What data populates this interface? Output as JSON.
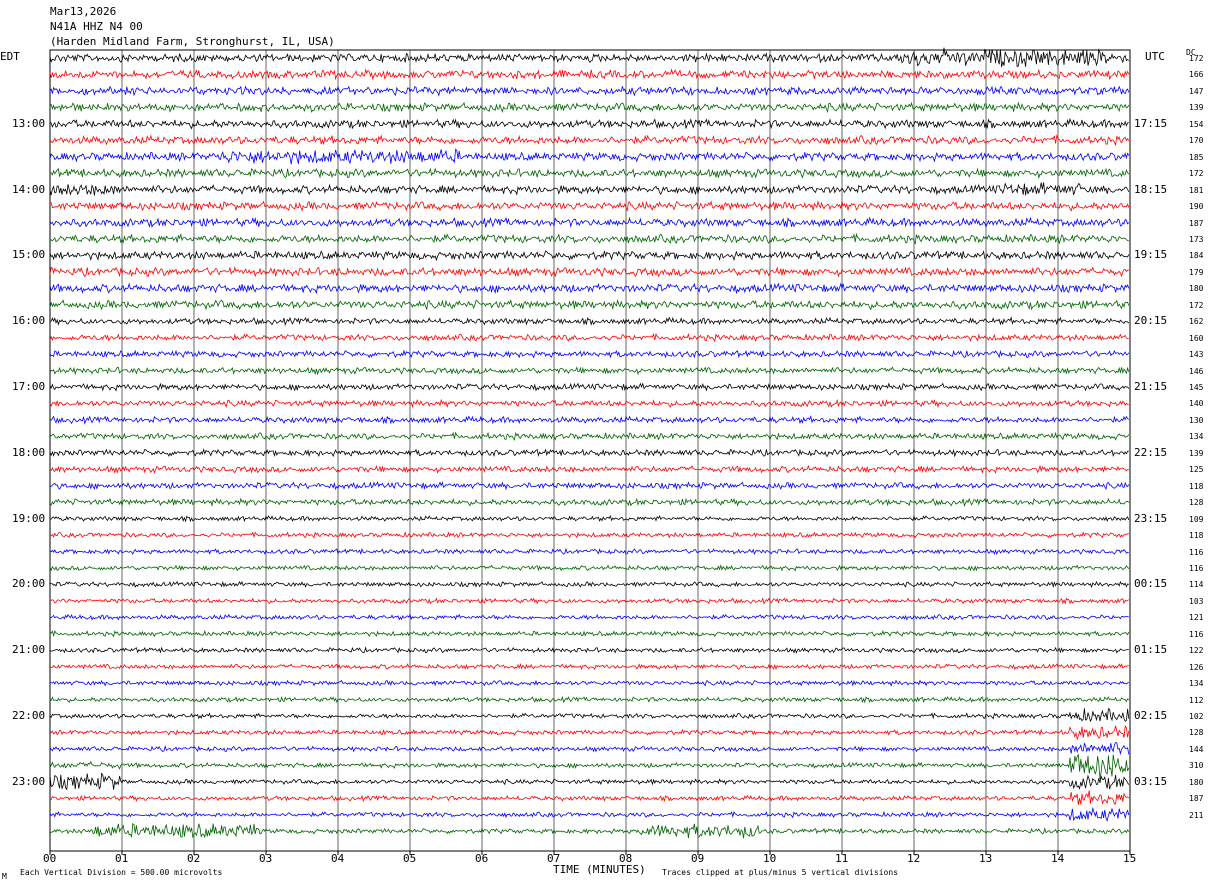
{
  "header": {
    "date": "Mar13,2026",
    "station": "N41A HHZ N4 00",
    "location": "(Harden Midland Farm, Stronghurst, IL, USA)"
  },
  "left_tz": "EDT",
  "right_tz": "UTC",
  "dc_header": "DC",
  "footer": {
    "scale_note": "Each Vertical Division =  500.00 microvolts",
    "clip_note": "Traces clipped at plus/minus 5 vertical divisions",
    "corner_mark": "M"
  },
  "colors": [
    "#000000",
    "#ff0000",
    "#0000ff",
    "#006400"
  ],
  "chart_data": {
    "type": "line",
    "xlabel": "TIME (MINUTES)",
    "x_ticks": [
      "00",
      "01",
      "02",
      "03",
      "04",
      "05",
      "06",
      "07",
      "08",
      "09",
      "10",
      "11",
      "12",
      "13",
      "14",
      "15"
    ],
    "xlim": [
      0,
      15
    ],
    "row_count": 48,
    "left_hour_labels": [
      "13:00",
      "14:00",
      "15:00",
      "16:00",
      "17:00",
      "18:00",
      "19:00",
      "20:00",
      "21:00",
      "22:00",
      "23:00"
    ],
    "right_hour_labels": [
      "17:15",
      "18:15",
      "19:15",
      "20:15",
      "21:15",
      "22:15",
      "23:15",
      "00:15",
      "01:15",
      "02:15",
      "03:15"
    ],
    "dc_offsets": [
      172,
      166,
      147,
      139,
      154,
      170,
      185,
      172,
      181,
      190,
      187,
      173,
      184,
      179,
      180,
      172,
      162,
      160,
      143,
      146,
      145,
      140,
      130,
      134,
      139,
      125,
      118,
      128,
      109,
      118,
      116,
      116,
      114,
      103,
      121,
      116,
      122,
      126,
      134,
      112,
      102,
      128,
      144,
      310,
      180,
      187,
      211
    ],
    "grid": "vertical minute lines"
  }
}
